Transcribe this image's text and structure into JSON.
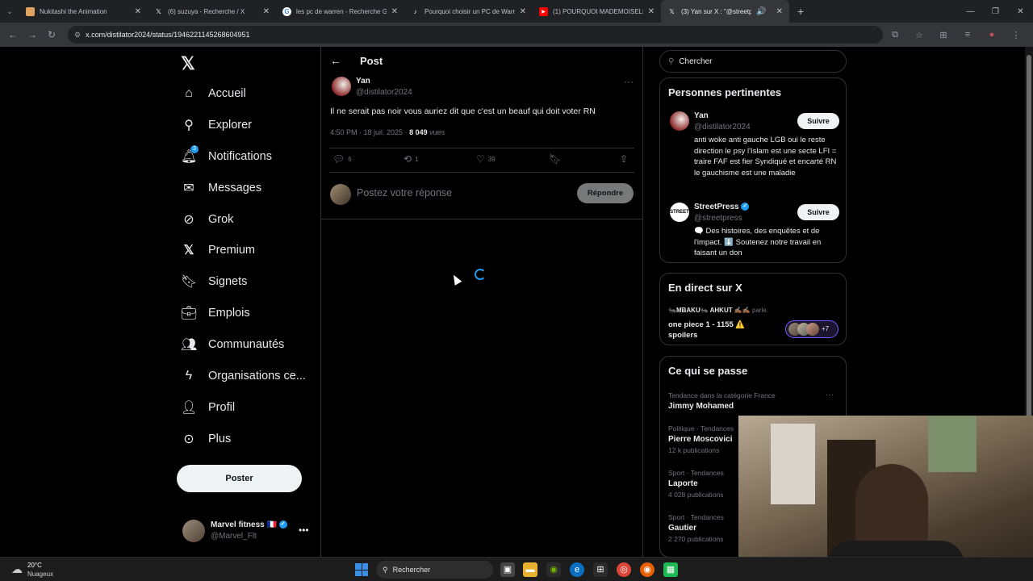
{
  "browser": {
    "tabs": [
      {
        "title": "Nukitashi the Animation",
        "icon": "image-favicon",
        "color": "#e0a060"
      },
      {
        "title": "(6) suzuya - Recherche / X",
        "icon": "x-favicon",
        "color": "#000000"
      },
      {
        "title": "les pc de warren - Recherche G",
        "icon": "google-favicon",
        "color": "#34a853"
      },
      {
        "title": "Pourquoi choisir un PC de Warr",
        "icon": "tiktok-favicon",
        "color": "#000000"
      },
      {
        "title": "(1) POURQUOI MADEMOISELLE",
        "icon": "youtube-favicon",
        "color": "#ff0000"
      },
      {
        "title": "(3) Yan sur X : \"@streetpres",
        "icon": "x-favicon",
        "color": "#000000"
      }
    ],
    "url": "x.com/distilator2024/status/1946221145268604951"
  },
  "nav": {
    "items": [
      {
        "label": "Accueil",
        "icon": "home-icon"
      },
      {
        "label": "Explorer",
        "icon": "search-icon"
      },
      {
        "label": "Notifications",
        "icon": "bell-icon",
        "badge": "3"
      },
      {
        "label": "Messages",
        "icon": "envelope-icon"
      },
      {
        "label": "Grok",
        "icon": "grok-icon"
      },
      {
        "label": "Premium",
        "icon": "x-logo-icon"
      },
      {
        "label": "Signets",
        "icon": "bookmark-icon"
      },
      {
        "label": "Emplois",
        "icon": "briefcase-icon"
      },
      {
        "label": "Communautés",
        "icon": "people-icon"
      },
      {
        "label": "Organisations ce...",
        "icon": "lightning-icon"
      },
      {
        "label": "Profil",
        "icon": "person-icon"
      },
      {
        "label": "Plus",
        "icon": "more-circle-icon"
      }
    ],
    "post_button": "Poster",
    "user": {
      "name": "Marvel fitness",
      "flag": "🇫🇷",
      "handle": "@Marvel_Flt"
    }
  },
  "main": {
    "title": "Post",
    "tweet": {
      "name": "Yan",
      "handle": "@distilator2024",
      "text": "Il ne serait pas noir vous auriez dit que c'est un beauf qui doit voter RN",
      "time": "4:50 PM · 18 juil. 2025 · ",
      "views": "8 049",
      "views_label": " vues",
      "replies": "6",
      "reposts": "1",
      "likes": "39"
    },
    "reply_placeholder": "Postez votre réponse",
    "reply_button": "Répondre"
  },
  "sidebar": {
    "search_placeholder": "Chercher",
    "relevant": {
      "title": "Personnes pertinentes",
      "people": [
        {
          "name": "Yan",
          "handle": "@distilator2024",
          "follow": "Suivre",
          "bio": "anti woke anti gauche LGB oui le reste direction le psy l'Islam est une secte LFI = traire FAF est fier Syndiqué et encarté RN le gauchisme est une maladie"
        },
        {
          "name": "StreetPress",
          "handle": "@streetpress",
          "follow": "Suivre",
          "bio": "🗨️ Des histoires, des enquêtes et de l'impact. ⬇️ Soutenez notre travail en faisant un don",
          "avatar_text": "STREET PRESS"
        }
      ]
    },
    "live": {
      "title": "En direct sur X",
      "host": "🐜MBAKU🐜 AHKUT ✍🏾✍🏾",
      "host_suffix": " parle.",
      "space_title": "one piece 1 - 1155 ⚠️ spoilers",
      "listeners": "+7"
    },
    "trends": {
      "title": "Ce qui se passe",
      "items": [
        {
          "category": "Tendance dans la catégorie France",
          "name": "Jimmy Mohamed",
          "count": ""
        },
        {
          "category": "Politique · Tendances",
          "name": "Pierre Moscovici",
          "count": "12 k publications"
        },
        {
          "category": "Sport · Tendances",
          "name": "Laporte",
          "count": "4 028 publications"
        },
        {
          "category": "Sport · Tendances",
          "name": "Gautier",
          "count": "2 270 publications"
        }
      ]
    }
  },
  "taskbar": {
    "temperature": "20°C",
    "weather": "Nuageux",
    "search": "Rechercher"
  }
}
